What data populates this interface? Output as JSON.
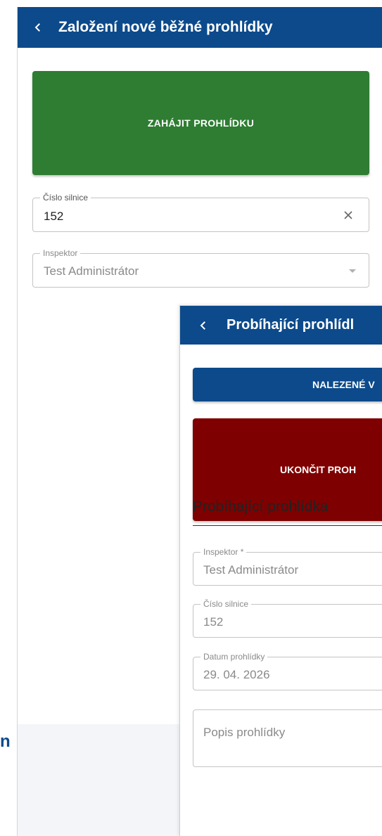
{
  "screen1": {
    "title": "Založení nové běžné prohlídky",
    "start_button": "ZAHÁJIT PROHLÍDKU",
    "road_field": {
      "label": "Číslo silnice",
      "value": "152"
    },
    "inspector_field": {
      "label": "Inspektor",
      "value": "Test Administrátor"
    },
    "brand_fragment": "n"
  },
  "screen2": {
    "title": "Probíhající prohlídl",
    "found_button": "NALEZENÉ V",
    "end_button": "UKONČIT PROH",
    "section_title": "Probíhající prohlídka",
    "inspector_field": {
      "label": "Inspektor *",
      "value": "Test Administrátor"
    },
    "road_field": {
      "label": "Číslo silnice",
      "value": "152"
    },
    "date_field": {
      "label": "Datum prohlídky",
      "value": "29. 04. 2026"
    },
    "description_field": {
      "placeholder": "Popis prohlídky"
    }
  },
  "icons": {
    "back": "chevron-left-icon",
    "clear": "close-icon",
    "dropdown": "caret-down-icon"
  },
  "colors": {
    "appbar": "#0c4a8b",
    "start": "#2e7d32",
    "end": "#7f0000",
    "found": "#0c4a8b"
  }
}
